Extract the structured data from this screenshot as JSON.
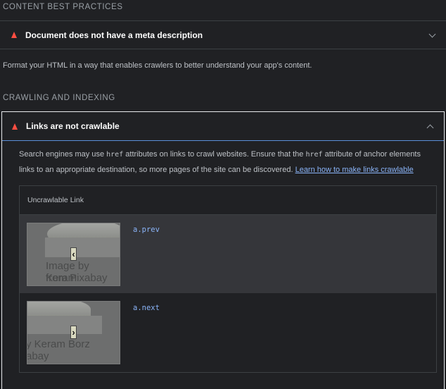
{
  "content_best_practices": {
    "title": "CONTENT BEST PRACTICES",
    "audit": {
      "title": "Document does not have a meta description"
    },
    "description": "Format your HTML in a way that enables crawlers to better understand your app's content."
  },
  "crawling_and_indexing": {
    "title": "CRAWLING AND INDEXING",
    "audit": {
      "title": "Links are not crawlable",
      "desc_part1": "Search engines may use ",
      "desc_code1": "href",
      "desc_part2": " attributes on links to crawl websites. Ensure that the ",
      "desc_code2": "href",
      "desc_part3": " attribute of anchor elements links to an appropriate destination, so more pages of the site can be discovered. ",
      "learn_more": "Learn how to make links crawlable"
    },
    "table": {
      "header": "Uncrawlable Link",
      "rows": [
        {
          "selector": "a.prev",
          "thumb_text_line1": "Image by Keram",
          "thumb_text_line2": "from Pixabay",
          "arrow": "‹"
        },
        {
          "selector": "a.next",
          "thumb_text_line1": "y Keram Borz",
          "thumb_text_line2": "abay",
          "arrow": "›"
        }
      ]
    }
  },
  "colors": {
    "fail": "#ff4e42",
    "link": "#8ab4f8",
    "background": "#202124"
  },
  "icons": {
    "fail": "triangle-fail-icon",
    "collapse": "chevron-down-icon",
    "expand": "chevron-up-icon"
  }
}
